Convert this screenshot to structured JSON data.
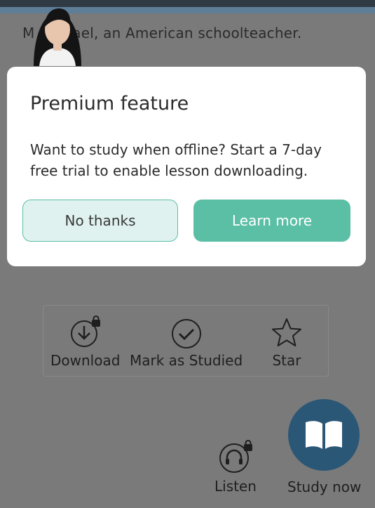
{
  "intro": {
    "text": "M   Michael, an American schoolteacher."
  },
  "modal": {
    "title": "Premium feature",
    "body": "Want to study when offline? Start a 7-day free trial to enable lesson downloading.",
    "secondary_label": "No thanks",
    "primary_label": "Learn more"
  },
  "actions": {
    "download": {
      "label": "Download",
      "icon": "download-locked-icon"
    },
    "mark_studied": {
      "label": "Mark as Studied",
      "icon": "check-circle-icon"
    },
    "star": {
      "label": "Star",
      "icon": "star-outline-icon"
    }
  },
  "bottom": {
    "listen_label": "Listen",
    "study_label": "Study now"
  },
  "colors": {
    "accent": "#5bbfa6",
    "fab": "#2b5776",
    "overlay": "#7a7a7a"
  }
}
